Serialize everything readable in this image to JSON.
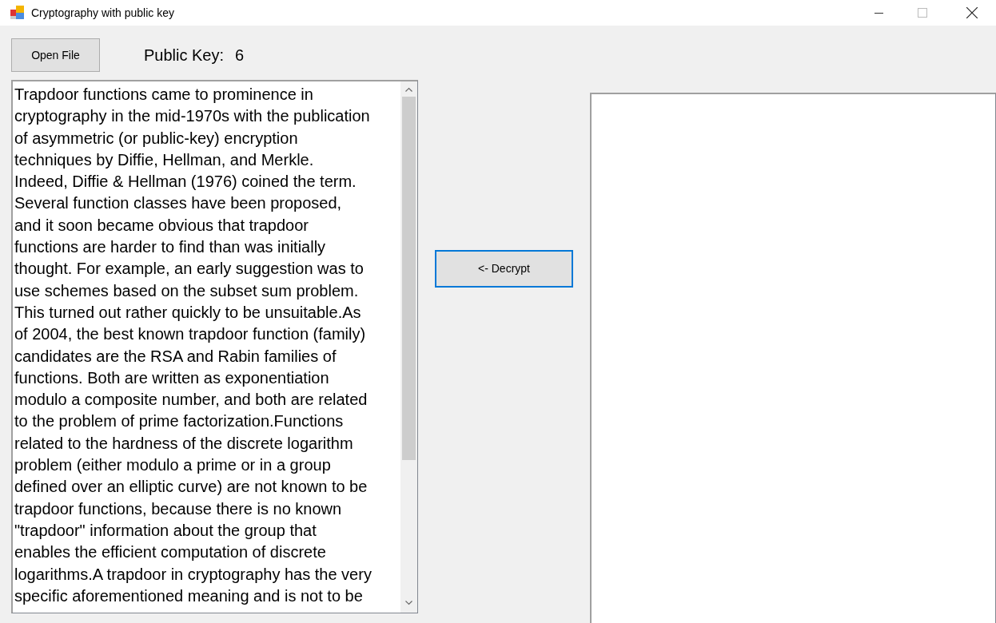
{
  "window": {
    "title": "Cryptography with public key"
  },
  "open_file_button": "Open File",
  "public_key": {
    "label": "Public Key:",
    "value": "6"
  },
  "source_text": {
    "lines": [
      "Trapdoor functions came to prominence in",
      "cryptography in the mid-1970s with the publication",
      "of asymmetric (or public-key) encryption",
      "techniques by Diffie, Hellman, and Merkle.",
      "Indeed, Diffie & Hellman (1976) coined the term.",
      "Several function classes have been proposed,",
      "and it soon became obvious that trapdoor",
      "functions are harder to find than was initially",
      "thought. For example, an early suggestion was to",
      "use schemes based on the subset sum problem.",
      "This turned out rather quickly to be unsuitable.As",
      "of 2004, the best known trapdoor function (family)",
      "candidates are the RSA and Rabin families of",
      "functions. Both are written as exponentiation",
      "modulo a composite number, and both are related",
      "to the problem of prime factorization.Functions",
      "related to the hardness of the discrete logarithm",
      "problem (either modulo a prime or in a group",
      "defined over an elliptic curve) are not known to be",
      "trapdoor functions, because there is no known",
      "\"trapdoor\" information about the group that",
      "enables the efficient computation of discrete",
      "logarithms.A trapdoor in cryptography has the very",
      "specific aforementioned meaning and is not to be"
    ]
  },
  "decrypt_button": "<- Decrypt"
}
